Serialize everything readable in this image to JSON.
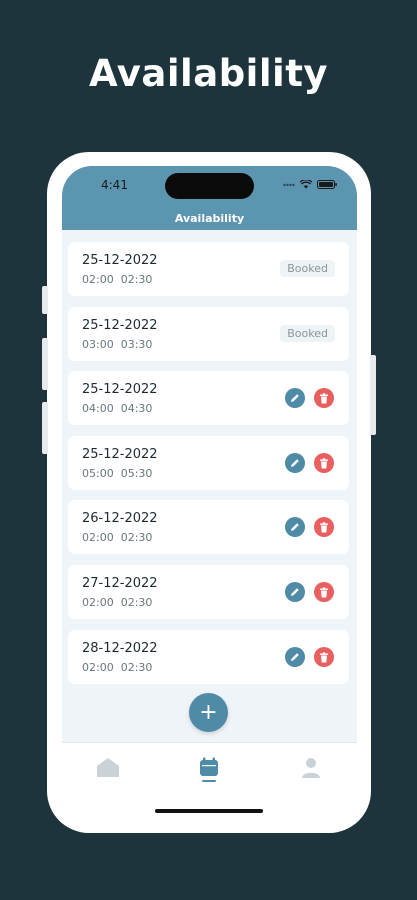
{
  "page": {
    "title": "Availability"
  },
  "status_bar": {
    "time": "4:41"
  },
  "header": {
    "title": "Availability"
  },
  "slots": [
    {
      "date": "25-12-2022",
      "start": "02:00",
      "end": "02:30",
      "status": "Booked"
    },
    {
      "date": "25-12-2022",
      "start": "03:00",
      "end": "03:30",
      "status": "Booked"
    },
    {
      "date": "25-12-2022",
      "start": "04:00",
      "end": "04:30",
      "status": ""
    },
    {
      "date": "25-12-2022",
      "start": "05:00",
      "end": "05:30",
      "status": ""
    },
    {
      "date": "26-12-2022",
      "start": "02:00",
      "end": "02:30",
      "status": ""
    },
    {
      "date": "27-12-2022",
      "start": "02:00",
      "end": "02:30",
      "status": ""
    },
    {
      "date": "28-12-2022",
      "start": "02:00",
      "end": "02:30",
      "status": ""
    }
  ],
  "fab": {
    "icon": "plus-icon",
    "label": "+"
  },
  "bottom_nav": {
    "items": [
      {
        "icon": "home-icon",
        "active": false
      },
      {
        "icon": "calendar-icon",
        "active": true
      },
      {
        "icon": "user-icon",
        "active": false
      }
    ]
  },
  "colors": {
    "background": "#1d343c",
    "header": "#5c95b0",
    "accent": "#4f8aa6",
    "delete": "#e95e5e",
    "inactive_icon": "#c9d2d6"
  }
}
